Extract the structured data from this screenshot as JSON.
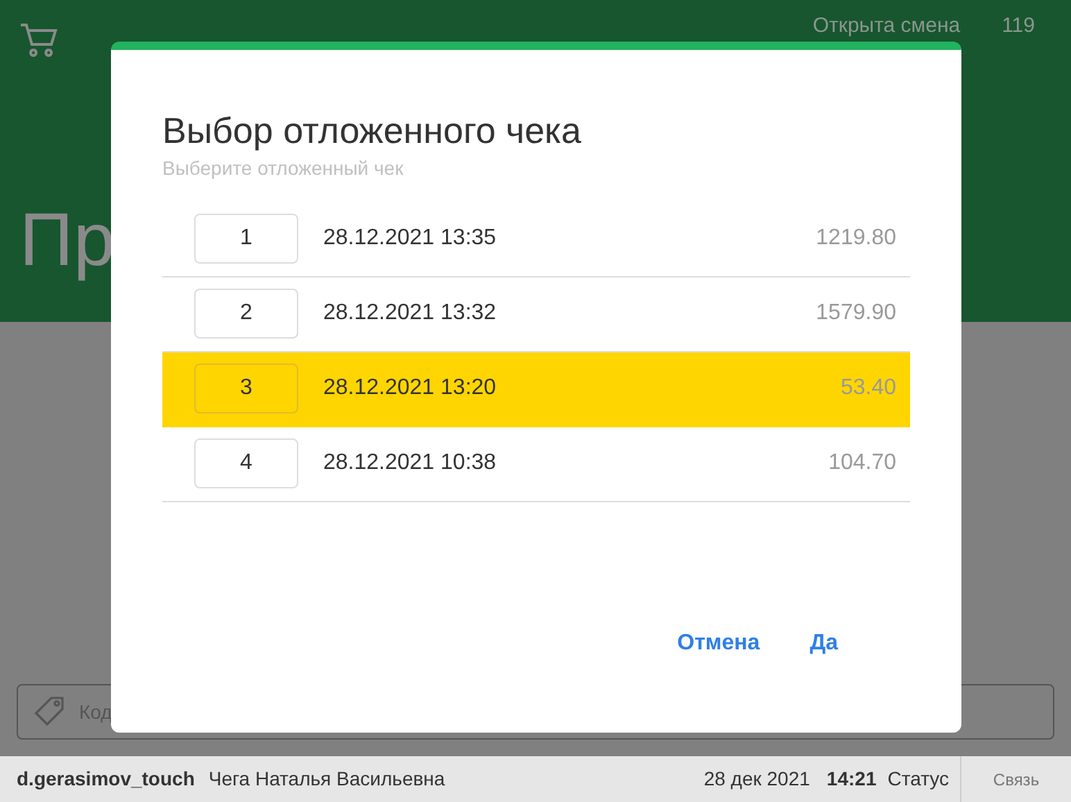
{
  "header": {
    "shift_status": "Открыта смена",
    "shift_number": "119",
    "page_title": "Пр"
  },
  "code_field": {
    "placeholder": "Код"
  },
  "status_bar": {
    "login": "d.gerasimov_touch",
    "cashier": "Чега Наталья Васильевна",
    "date": "28 дек 2021",
    "time": "14:21",
    "status": "Статус",
    "connection": "Связь"
  },
  "dialog": {
    "title": "Выбор отложенного чека",
    "subtitle": "Выберите отложенный чек",
    "rows": [
      {
        "number": "1",
        "datetime": "28.12.2021 13:35",
        "amount": "1219.80",
        "selected": false
      },
      {
        "number": "2",
        "datetime": "28.12.2021 13:32",
        "amount": "1579.90",
        "selected": false
      },
      {
        "number": "3",
        "datetime": "28.12.2021 13:20",
        "amount": "53.40",
        "selected": true
      },
      {
        "number": "4",
        "datetime": "28.12.2021 10:38",
        "amount": "104.70",
        "selected": false
      }
    ],
    "buttons": [
      "Отмена",
      "Да"
    ]
  }
}
